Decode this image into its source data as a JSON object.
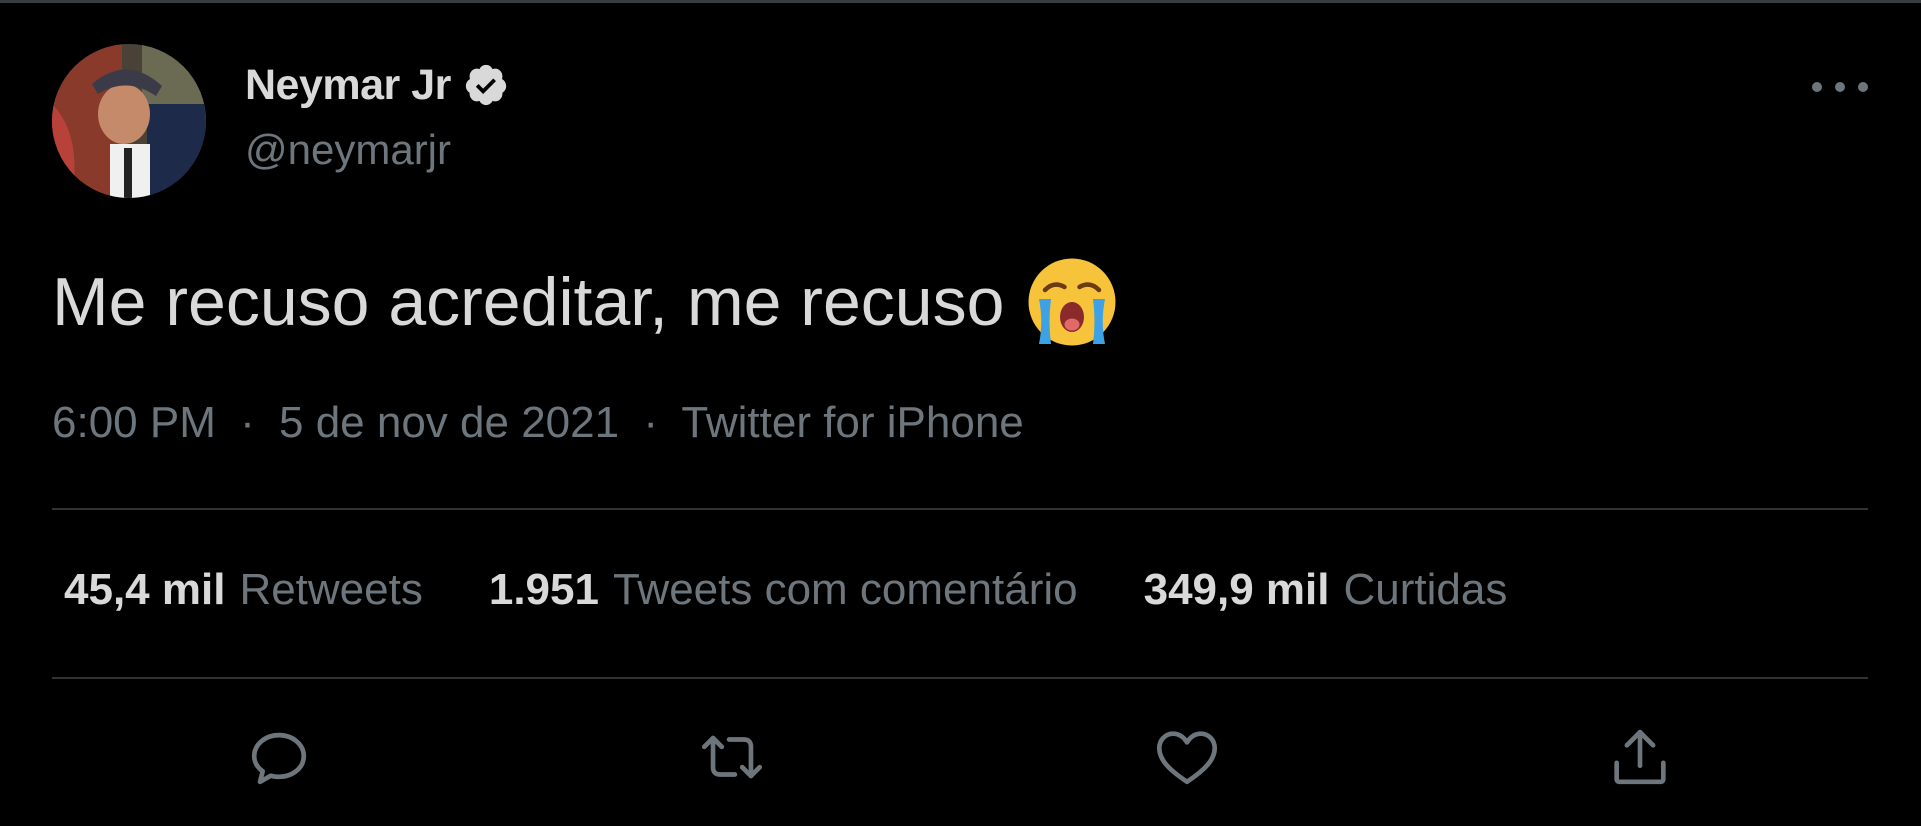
{
  "tweet": {
    "author": {
      "display_name": "Neymar Jr",
      "handle": "@neymarjr",
      "verified_icon": "verified-badge-icon",
      "avatar_icon": "avatar"
    },
    "text": "Me recuso acreditar, me recuso",
    "emoji": "loudly-crying-face-icon",
    "meta": {
      "time": "6:00 PM",
      "separator": "·",
      "date": "5 de nov de 2021",
      "source": "Twitter for iPhone"
    },
    "stats": [
      {
        "count": "45,4 mil",
        "label": "Retweets"
      },
      {
        "count": "1.951",
        "label": "Tweets com comentário"
      },
      {
        "count": "349,9 mil",
        "label": "Curtidas"
      }
    ],
    "actions": [
      "reply-icon",
      "retweet-icon",
      "like-icon",
      "share-icon"
    ]
  },
  "colors": {
    "background": "#000000",
    "primary_text": "#d9d9d9",
    "secondary_text": "#6e767d",
    "divider": "#2f3336"
  }
}
